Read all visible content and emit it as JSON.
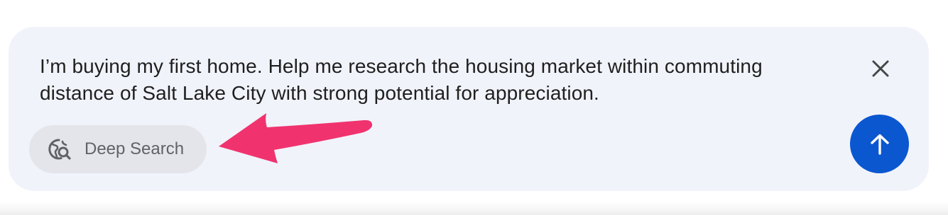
{
  "prompt": {
    "text": "I’m buying my first home. Help me research the housing market within commuting distance of Salt Lake City with strong potential for appreciation."
  },
  "chip": {
    "label": "Deep Search",
    "icon": "deep-search-icon"
  },
  "buttons": {
    "close_icon": "close-icon",
    "send_icon": "arrow-up-icon"
  },
  "colors": {
    "card_background": "#f1f3fb",
    "chip_background": "#e4e5ea",
    "send_button": "#0b57d0",
    "annotation_arrow": "#f0336e"
  }
}
